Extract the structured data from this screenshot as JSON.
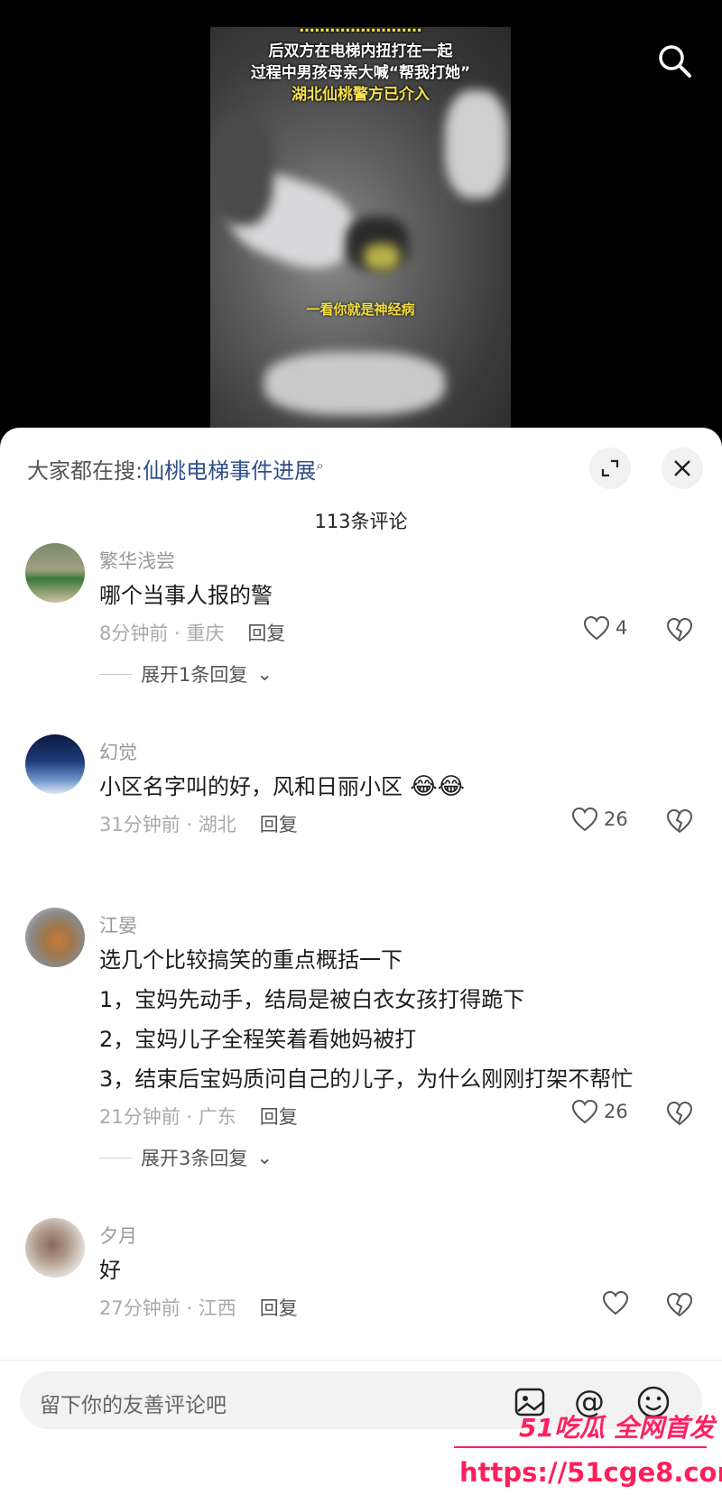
{
  "video": {
    "caption_top": "……………………",
    "caption_lines": [
      "后双方在电梯内扭打在一起",
      "过程中男孩母亲大喊“帮我打她”",
      "湖北仙桃警方已介入"
    ],
    "subtitle": "一看你就是神经病"
  },
  "sheet": {
    "hot_search_prefix": "大家都在搜:",
    "hot_search_term": "仙桃电梯事件进展",
    "comment_count": "113条评论"
  },
  "comments": [
    {
      "user": "繁华浅尝",
      "text": "哪个当事人报的警",
      "time_loc": "8分钟前 · 重庆",
      "reply": "回复",
      "likes": "4",
      "expand": "展开1条回复"
    },
    {
      "user": "幻觉",
      "text": "小区名字叫的好，风和日丽小区",
      "time_loc": "31分钟前 · 湖北",
      "reply": "回复",
      "likes": "26"
    },
    {
      "user": "江晏",
      "lines": [
        "选几个比较搞笑的重点概括一下",
        "1，宝妈先动手，结局是被白衣女孩打得跪下",
        "2，宝妈儿子全程笑着看她妈被打",
        "3，结束后宝妈质问自己的儿子，为什么刚刚打架不帮忙"
      ],
      "time_loc": "21分钟前 · 广东",
      "reply": "回复",
      "likes": "26",
      "expand": "展开3条回复"
    },
    {
      "user": "夕月",
      "text": "好",
      "time_loc": "27分钟前 · 江西",
      "reply": "回复",
      "likes": ""
    }
  ],
  "input": {
    "placeholder": "留下你的友善评论吧"
  },
  "watermark": {
    "brand": "51吃瓜 全网首发",
    "url": "https://51cge8.com"
  },
  "colors": {
    "sheet_bg": "#ffffff",
    "link": "#2f4f8a",
    "watermark": "#ff2060"
  }
}
